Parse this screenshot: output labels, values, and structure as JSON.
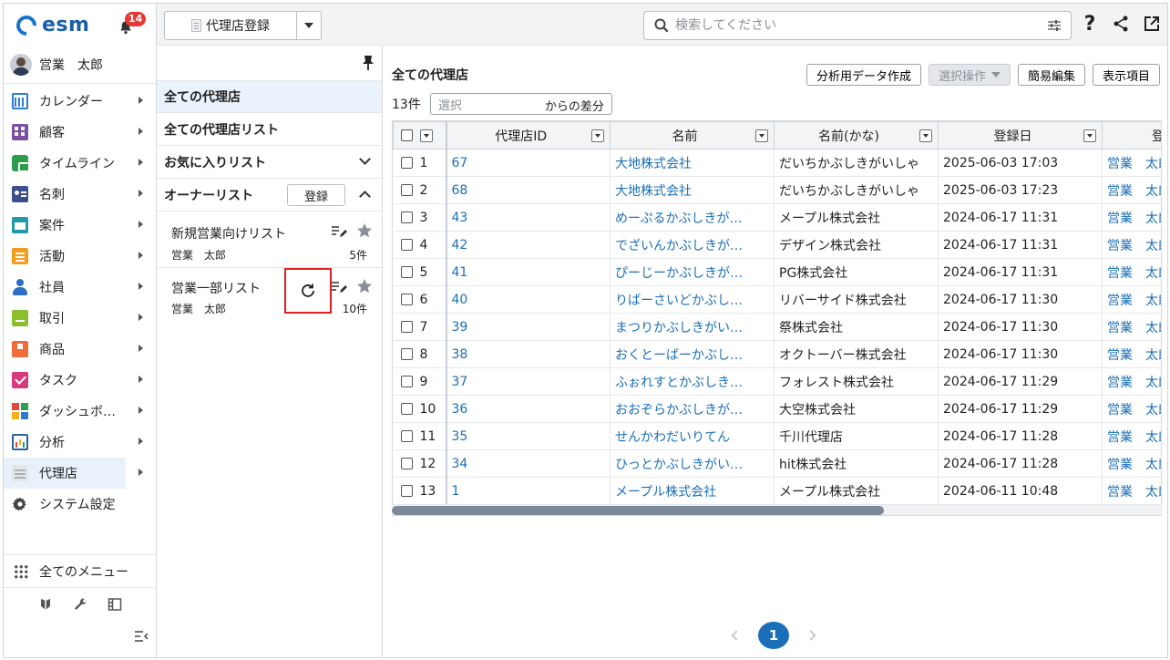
{
  "brand": {
    "name": "esm"
  },
  "notifications": {
    "count": "14"
  },
  "user": {
    "name": "営業　太郎"
  },
  "nav": {
    "items": [
      {
        "label": "カレンダー",
        "icon": "calendar-icon",
        "arrow": true
      },
      {
        "label": "顧客",
        "icon": "customer-icon",
        "arrow": true
      },
      {
        "label": "タイムライン",
        "icon": "timeline-icon",
        "arrow": true
      },
      {
        "label": "名刺",
        "icon": "business-card-icon",
        "arrow": true
      },
      {
        "label": "案件",
        "icon": "deal-icon",
        "arrow": true
      },
      {
        "label": "活動",
        "icon": "activity-icon",
        "arrow": true
      },
      {
        "label": "社員",
        "icon": "employee-icon",
        "arrow": true
      },
      {
        "label": "取引",
        "icon": "trade-icon",
        "arrow": true
      },
      {
        "label": "商品",
        "icon": "product-icon",
        "arrow": true
      },
      {
        "label": "タスク",
        "icon": "task-icon",
        "arrow": true
      },
      {
        "label": "ダッシュボ…",
        "icon": "dashboard-icon",
        "arrow": true
      },
      {
        "label": "分析",
        "icon": "analysis-icon",
        "arrow": true
      },
      {
        "label": "代理店",
        "icon": "agency-icon",
        "arrow": true,
        "active": true
      },
      {
        "label": "システム設定",
        "icon": "gear-icon",
        "arrow": false
      }
    ],
    "all_menu_label": "全てのメニュー"
  },
  "topbar": {
    "register_label": "代理店登録",
    "search_placeholder": "検索してください"
  },
  "lists": {
    "all_agencies": "全ての代理店",
    "all_agency_list": "全ての代理店リスト",
    "favorites": "お気に入りリスト",
    "owner_list": "オーナーリスト",
    "register_button": "登録",
    "sub_lists": [
      {
        "title": "新規営業向けリスト",
        "owner": "営業　太郎",
        "count": "5件"
      },
      {
        "title": "営業一部リスト",
        "owner": "営業　太郎",
        "count": "10件"
      }
    ]
  },
  "main": {
    "title": "全ての代理店",
    "actions": {
      "analysis": "分析用データ作成",
      "select_ops": "選択操作",
      "quick_edit": "簡易編集",
      "display_items": "表示項目"
    },
    "count": "13件",
    "diff_placeholder": "選択",
    "diff_suffix": "からの差分"
  },
  "table": {
    "columns": [
      "代理店ID",
      "名前",
      "名前(かな)",
      "登録日",
      "登"
    ],
    "rows": [
      {
        "n": "1",
        "id": "67",
        "name": "大地株式会社",
        "kana": "だいちかぶしきがいしゃ",
        "date": "2025-06-03 17:03",
        "owner": "営業　太郎"
      },
      {
        "n": "2",
        "id": "68",
        "name": "大地株式会社",
        "kana": "だいちかぶしきがいしゃ",
        "date": "2025-06-03 17:23",
        "owner": "営業　太郎"
      },
      {
        "n": "3",
        "id": "43",
        "name": "めーぷるかぶしきが…",
        "kana": "メープル株式会社",
        "date": "2024-06-17 11:31",
        "owner": "営業　太郎"
      },
      {
        "n": "4",
        "id": "42",
        "name": "でざいんかぶしきが…",
        "kana": "デザイン株式会社",
        "date": "2024-06-17 11:31",
        "owner": "営業　太郎"
      },
      {
        "n": "5",
        "id": "41",
        "name": "ぴーじーかぶしきが…",
        "kana": "PG株式会社",
        "date": "2024-06-17 11:31",
        "owner": "営業　太郎"
      },
      {
        "n": "6",
        "id": "40",
        "name": "りばーさいどかぶし…",
        "kana": "リバーサイド株式会社",
        "date": "2024-06-17 11:30",
        "owner": "営業　太郎"
      },
      {
        "n": "7",
        "id": "39",
        "name": "まつりかぶしきがい…",
        "kana": "祭株式会社",
        "date": "2024-06-17 11:30",
        "owner": "営業　太郎"
      },
      {
        "n": "8",
        "id": "38",
        "name": "おくとーばーかぶし…",
        "kana": "オクトーバー株式会社",
        "date": "2024-06-17 11:30",
        "owner": "営業　太郎"
      },
      {
        "n": "9",
        "id": "37",
        "name": "ふぉれすとかぶしき…",
        "kana": "フォレスト株式会社",
        "date": "2024-06-17 11:29",
        "owner": "営業　太郎"
      },
      {
        "n": "10",
        "id": "36",
        "name": "おおぞらかぶしきが…",
        "kana": "大空株式会社",
        "date": "2024-06-17 11:29",
        "owner": "営業　太郎"
      },
      {
        "n": "11",
        "id": "35",
        "name": "せんかわだいりてん",
        "kana": "千川代理店",
        "date": "2024-06-17 11:28",
        "owner": "営業　太郎"
      },
      {
        "n": "12",
        "id": "34",
        "name": "ひっとかぶしきがい…",
        "kana": "hit株式会社",
        "date": "2024-06-17 11:28",
        "owner": "営業　太郎"
      },
      {
        "n": "13",
        "id": "1",
        "name": "メープル株式会社",
        "kana": "メープル株式会社",
        "date": "2024-06-11 10:48",
        "owner": "営業　太郎"
      }
    ]
  },
  "pager": {
    "current": "1"
  },
  "colors": {
    "accent": "#1a6fb8",
    "highlight": "#e02020",
    "badge": "#e53935"
  }
}
